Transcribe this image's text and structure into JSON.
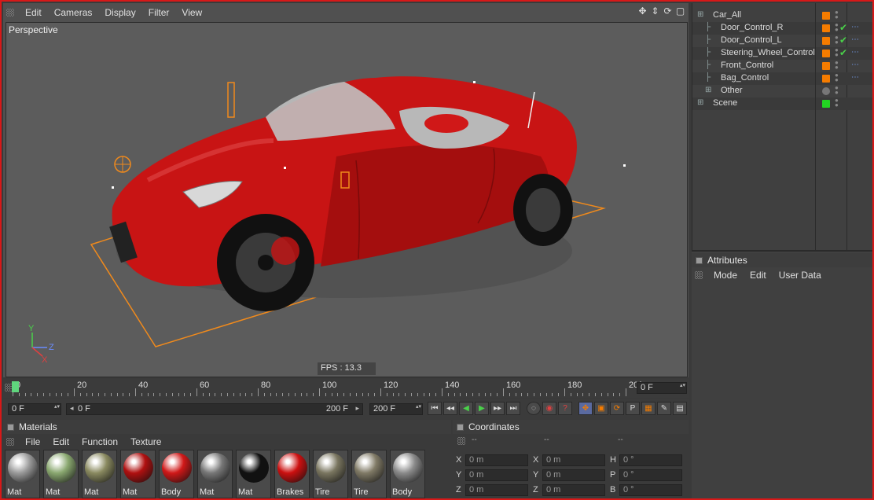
{
  "viewport": {
    "menu": [
      "Edit",
      "Cameras",
      "Display",
      "Filter",
      "View"
    ],
    "label": "Perspective",
    "fps": "FPS : 13.3",
    "nav_icons": [
      "move-icon",
      "zoom-icon",
      "rotate-icon",
      "maximize-icon"
    ]
  },
  "timeline": {
    "ticks": [
      "0",
      "20",
      "40",
      "60",
      "80",
      "100",
      "120",
      "140",
      "160",
      "180",
      "20("
    ],
    "current_frame": "0 F",
    "start_field": "0 F",
    "range_start": "0 F",
    "range_end": "200 F",
    "end_field": "200 F"
  },
  "materials": {
    "title": "Materials",
    "menu": [
      "File",
      "Edit",
      "Function",
      "Texture"
    ],
    "items": [
      {
        "label": "Mat",
        "color": "#9a9a9a"
      },
      {
        "label": "Mat",
        "color": "#8aa870"
      },
      {
        "label": "Mat",
        "color": "#8a8a60"
      },
      {
        "label": "Mat",
        "color": "#b01010"
      },
      {
        "label": "Body",
        "color": "#d01818"
      },
      {
        "label": "Mat",
        "color": "#777777"
      },
      {
        "label": "Mat",
        "color": "#111111"
      },
      {
        "label": "Brakes",
        "color": "#cc1010"
      },
      {
        "label": "Tire",
        "color": "#7a7660"
      },
      {
        "label": "Tire",
        "color": "#807a66"
      },
      {
        "label": "Body",
        "color": "#8a8a8a"
      }
    ]
  },
  "coordinates": {
    "title": "Coordinates",
    "headers": [
      "--",
      "--",
      "--"
    ],
    "rows": [
      {
        "a1": "X",
        "v1": "0 m",
        "a2": "X",
        "v2": "0 m",
        "a3": "H",
        "v3": "0 °"
      },
      {
        "a1": "Y",
        "v1": "0 m",
        "a2": "Y",
        "v2": "0 m",
        "a3": "P",
        "v3": "0 °"
      },
      {
        "a1": "Z",
        "v1": "0 m",
        "a2": "Z",
        "v2": "0 m",
        "a3": "B",
        "v3": "0 °"
      }
    ]
  },
  "objects": {
    "items": [
      {
        "name": "Car_All",
        "tag": "#f57c00",
        "check": ""
      },
      {
        "name": "Door_Control_R",
        "tag": "#f57c00",
        "check": "✔"
      },
      {
        "name": "Door_Control_L",
        "tag": "#f57c00",
        "check": "✔"
      },
      {
        "name": "Steering_Wheel_Control",
        "tag": "#f57c00",
        "check": "✔"
      },
      {
        "name": "Front_Control",
        "tag": "#f57c00",
        "check": ""
      },
      {
        "name": "Bag_Control",
        "tag": "#f57c00",
        "check": ""
      },
      {
        "name": "Other",
        "tag": "#777777",
        "check": ""
      },
      {
        "name": "Scene",
        "tag": "#22d422",
        "check": ""
      }
    ]
  },
  "attributes": {
    "title": "Attributes",
    "menu": [
      "Mode",
      "Edit",
      "User Data"
    ]
  },
  "colors": {
    "accent_orange": "#f57c00",
    "frame_red": "#d81818",
    "car_red": "#c81414"
  }
}
